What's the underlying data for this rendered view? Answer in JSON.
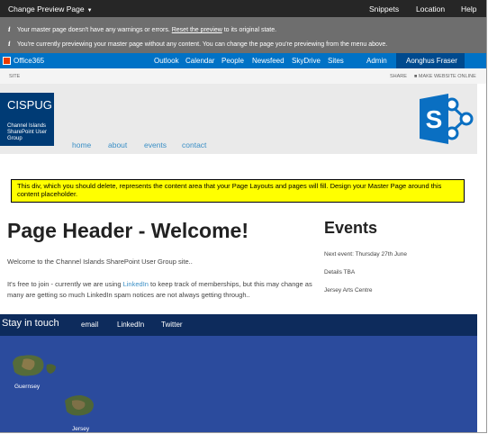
{
  "preview_bar": {
    "title": "Change Preview Page",
    "links": [
      "Snippets",
      "Location",
      "Help"
    ]
  },
  "notices": {
    "line1_pre": "Your master page doesn't have any warnings or errors.",
    "line1_link": "Reset the preview",
    "line1_post": "to its original state.",
    "line2": "You're currently previewing your master page without any content. You can change the page you're previewing from the menu above."
  },
  "suite": {
    "brand": "Office365",
    "nav": [
      "Outlook",
      "Calendar",
      "People",
      "Newsfeed",
      "SkyDrive",
      "Sites",
      "Admin"
    ],
    "user": "Aonghus Fraser"
  },
  "ribbon": {
    "left": "SITE",
    "share": "SHARE",
    "make_online": "MAKE WEBSITE ONLINE"
  },
  "site": {
    "title": "CISPUG",
    "subtitle": "Channel Islands SharePoint User Group",
    "nav": [
      "home",
      "about",
      "events",
      "contact"
    ]
  },
  "placeholder_text": "This div, which you should delete, represents the content area that your Page Layouts and pages will fill. Design your Master Page around this content placeholder.",
  "main": {
    "heading": "Page Header - Welcome!",
    "intro": "Welcome to the Channel Islands SharePoint User Group site..",
    "para_pre": "It's free to join - currently we are using",
    "para_link": "LinkedIn",
    "para_post": "to keep track of memberships, but this may change as many are getting so much LinkedIn spam notices are not always getting through.."
  },
  "events": {
    "heading": "Events",
    "items": [
      "Next event: Thursday 27th June",
      "Details TBA",
      "Jersey Arts Centre"
    ]
  },
  "footer": {
    "stay": "Stay in touch",
    "links": [
      "email",
      "LinkedIn",
      "Twitter"
    ],
    "map_labels": [
      "Guernsey",
      "Jersey"
    ]
  },
  "colors": {
    "suite_blue": "#0072c6",
    "footer_navy": "#0d2b5c",
    "map_blue": "#2b4b9d",
    "placeholder_yellow": "#ffff00"
  }
}
